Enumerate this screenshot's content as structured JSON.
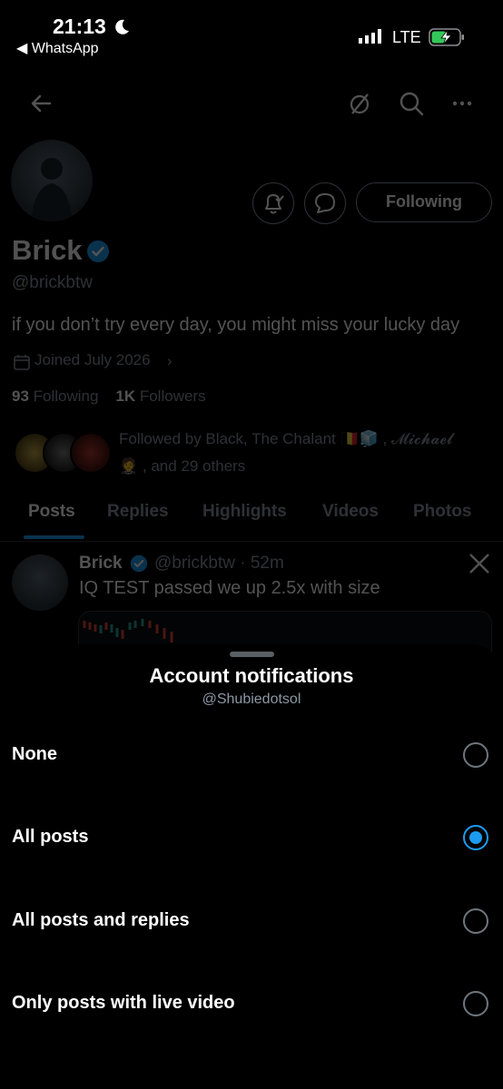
{
  "status_bar": {
    "time": "21:13",
    "back_app": "◀ WhatsApp",
    "network": "LTE"
  },
  "profile": {
    "following_button": "Following",
    "name": "Brick",
    "handle": "@brickbtw",
    "bio": "if you don’t try every day, you might miss your lucky day",
    "joined": "Joined July 2026",
    "following_count": "93",
    "following_label": "Following",
    "followers_count": "1K",
    "followers_label": "Followers",
    "followed_by_line1": "Followed by Black, The Chalant 🇧🇪🧊 , 𝓜𝓲𝓬𝓱𝓪𝓮𝓵",
    "followed_by_line2": "🤵 , and 29 others",
    "tabs": [
      "Posts",
      "Replies",
      "Highlights",
      "Videos",
      "Photos"
    ],
    "active_tab": "Posts",
    "post": {
      "name": "Brick",
      "meta": "@brickbtw · 52m",
      "text": "IQ TEST passed we up 2.5x with size"
    }
  },
  "sheet": {
    "title": "Account notifications",
    "subtitle": "@Shubiedotsol",
    "options": [
      {
        "label": "None",
        "selected": false
      },
      {
        "label": "All posts",
        "selected": true
      },
      {
        "label": "All posts and replies",
        "selected": false
      },
      {
        "label": "Only posts with live video",
        "selected": false
      }
    ]
  },
  "colors": {
    "accent": "#1d9bf0",
    "background": "#000000",
    "muted_text": "#8b98a5"
  }
}
